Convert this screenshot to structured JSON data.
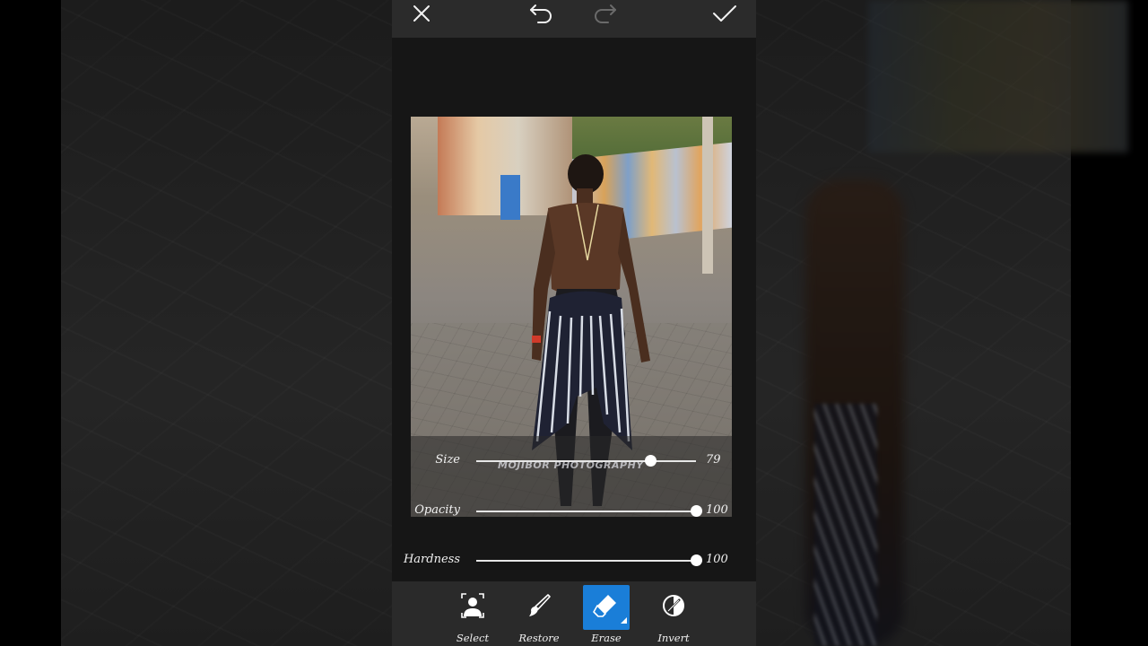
{
  "topbar": {
    "close_icon": "close-icon",
    "undo_icon": "undo-icon",
    "redo_icon": "redo-icon",
    "apply_icon": "checkmark-icon"
  },
  "watermark": "MOJIBOR PHOTOGRAPHY",
  "sliders": [
    {
      "label": "Size",
      "value": "79",
      "level": 0.79
    },
    {
      "label": "Opacity",
      "value": "100",
      "level": 1.0
    },
    {
      "label": "Hardness",
      "value": "100",
      "level": 1.0
    }
  ],
  "tools": [
    {
      "label": "Select",
      "icon": "person-select-icon",
      "active": false
    },
    {
      "label": "Restore",
      "icon": "brush-icon",
      "active": false
    },
    {
      "label": "Erase",
      "icon": "eraser-icon",
      "active": true
    },
    {
      "label": "Invert",
      "icon": "invert-icon",
      "active": false
    }
  ],
  "colors": {
    "accent": "#1a7ed8",
    "toolbar_bg": "#2a2a2a",
    "canvas_bg": "#161616"
  }
}
